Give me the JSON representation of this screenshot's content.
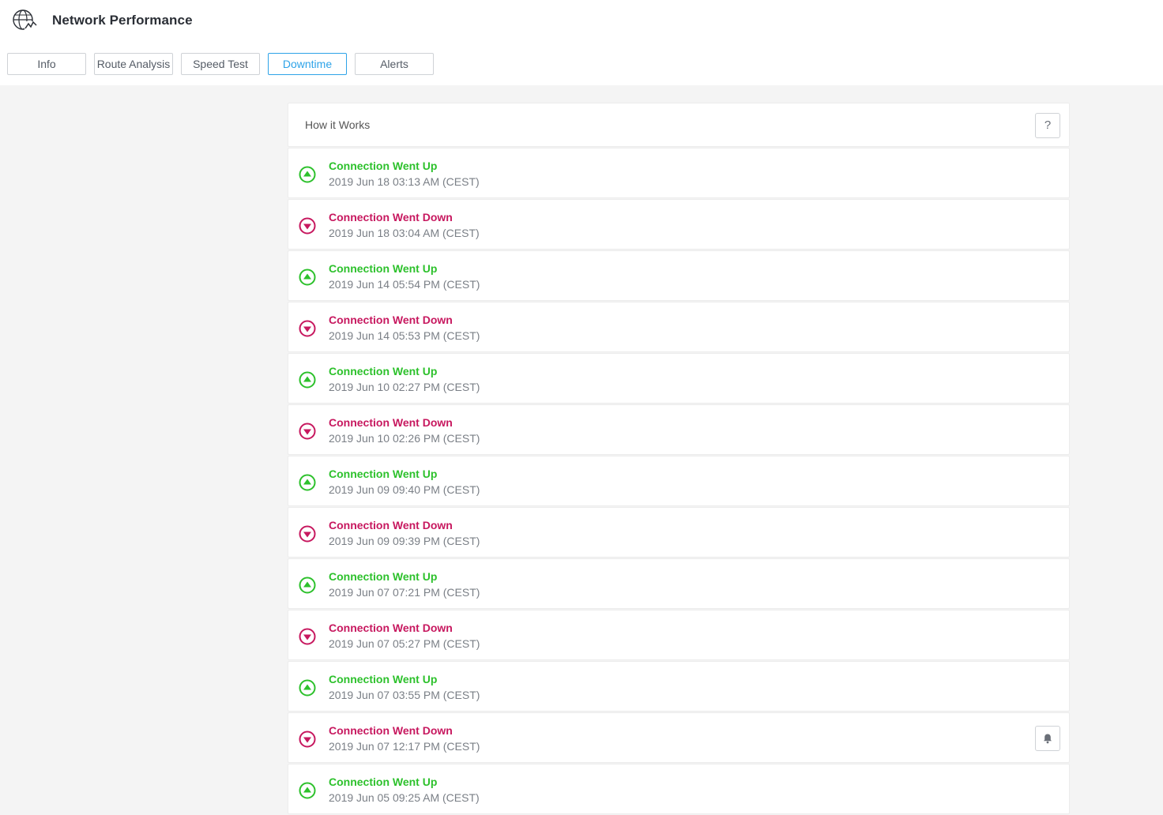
{
  "app": {
    "title": "Network Performance",
    "logo_icon": "globe-chart-icon"
  },
  "tabs": [
    {
      "label": "Info",
      "active": false
    },
    {
      "label": "Route Analysis",
      "active": false
    },
    {
      "label": "Speed Test",
      "active": false
    },
    {
      "label": "Downtime",
      "active": true
    },
    {
      "label": "Alerts",
      "active": false
    }
  ],
  "panel": {
    "header_title": "How it Works",
    "help_label": "?"
  },
  "colors": {
    "up": "#2dc12c",
    "down": "#c7185f",
    "accent": "#2ea3e8"
  },
  "events": [
    {
      "type": "up",
      "status": "Connection Went Up",
      "time": "2019 Jun 18 03:13 AM (CEST)"
    },
    {
      "type": "down",
      "status": "Connection Went Down",
      "time": "2019 Jun 18 03:04 AM (CEST)"
    },
    {
      "type": "up",
      "status": "Connection Went Up",
      "time": "2019 Jun 14 05:54 PM (CEST)"
    },
    {
      "type": "down",
      "status": "Connection Went Down",
      "time": "2019 Jun 14 05:53 PM (CEST)"
    },
    {
      "type": "up",
      "status": "Connection Went Up",
      "time": "2019 Jun 10 02:27 PM (CEST)"
    },
    {
      "type": "down",
      "status": "Connection Went Down",
      "time": "2019 Jun 10 02:26 PM (CEST)"
    },
    {
      "type": "up",
      "status": "Connection Went Up",
      "time": "2019 Jun 09 09:40 PM (CEST)"
    },
    {
      "type": "down",
      "status": "Connection Went Down",
      "time": "2019 Jun 09 09:39 PM (CEST)"
    },
    {
      "type": "up",
      "status": "Connection Went Up",
      "time": "2019 Jun 07 07:21 PM (CEST)"
    },
    {
      "type": "down",
      "status": "Connection Went Down",
      "time": "2019 Jun 07 05:27 PM (CEST)"
    },
    {
      "type": "up",
      "status": "Connection Went Up",
      "time": "2019 Jun 07 03:55 PM (CEST)"
    },
    {
      "type": "down",
      "status": "Connection Went Down",
      "time": "2019 Jun 07 12:17 PM (CEST)"
    },
    {
      "type": "up",
      "status": "Connection Went Up",
      "time": "2019 Jun 05 09:25 AM (CEST)"
    }
  ],
  "bell_button": {
    "icon": "bell-icon"
  }
}
